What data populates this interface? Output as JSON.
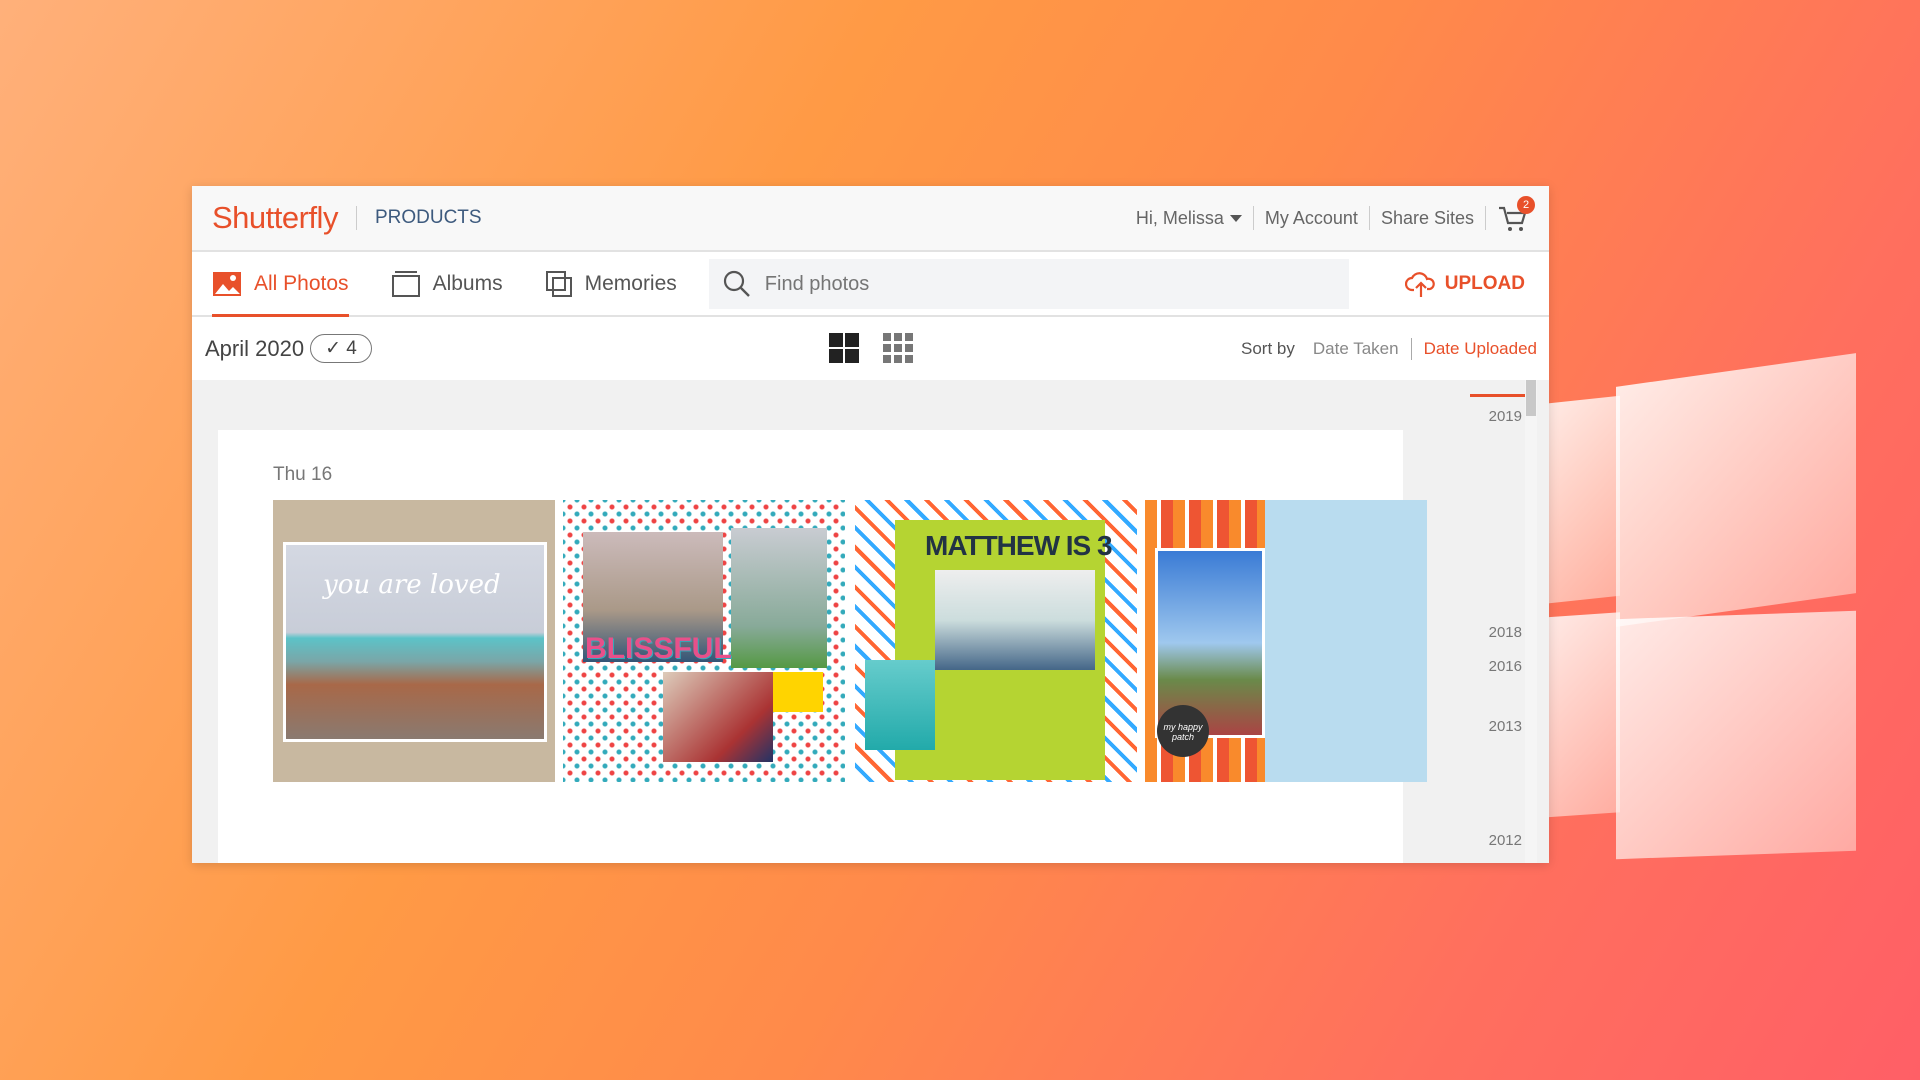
{
  "header": {
    "logo": "Shutterfly",
    "products": "PRODUCTS",
    "greeting": "Hi, Melissa",
    "my_account": "My Account",
    "share_sites": "Share Sites",
    "cart_count": "2"
  },
  "nav": {
    "tabs": [
      {
        "label": "All Photos",
        "icon": "image-icon",
        "active": true
      },
      {
        "label": "Albums",
        "icon": "album-icon"
      },
      {
        "label": "Memories",
        "icon": "memories-icon"
      }
    ],
    "search_placeholder": "Find photos",
    "upload": "UPLOAD"
  },
  "toolbar": {
    "month": "April 2020",
    "selected_count": "✓ 4",
    "sort_label": "Sort by",
    "sort_options": [
      "Date Taken",
      "Date Uploaded"
    ],
    "active_sort": "Date Uploaded"
  },
  "content": {
    "day": "Thu 16",
    "photos": [
      {
        "caption": "you are loved"
      },
      {
        "caption": "BLISSFUL"
      },
      {
        "caption": "MATTHEW IS 3"
      },
      {
        "caption": "my happy patch"
      }
    ]
  },
  "timeline": {
    "years": [
      "2019",
      "2018",
      "2016",
      "2013",
      "2012"
    ]
  },
  "colors": {
    "accent": "#e8502a",
    "products": "#3d5a7e"
  }
}
